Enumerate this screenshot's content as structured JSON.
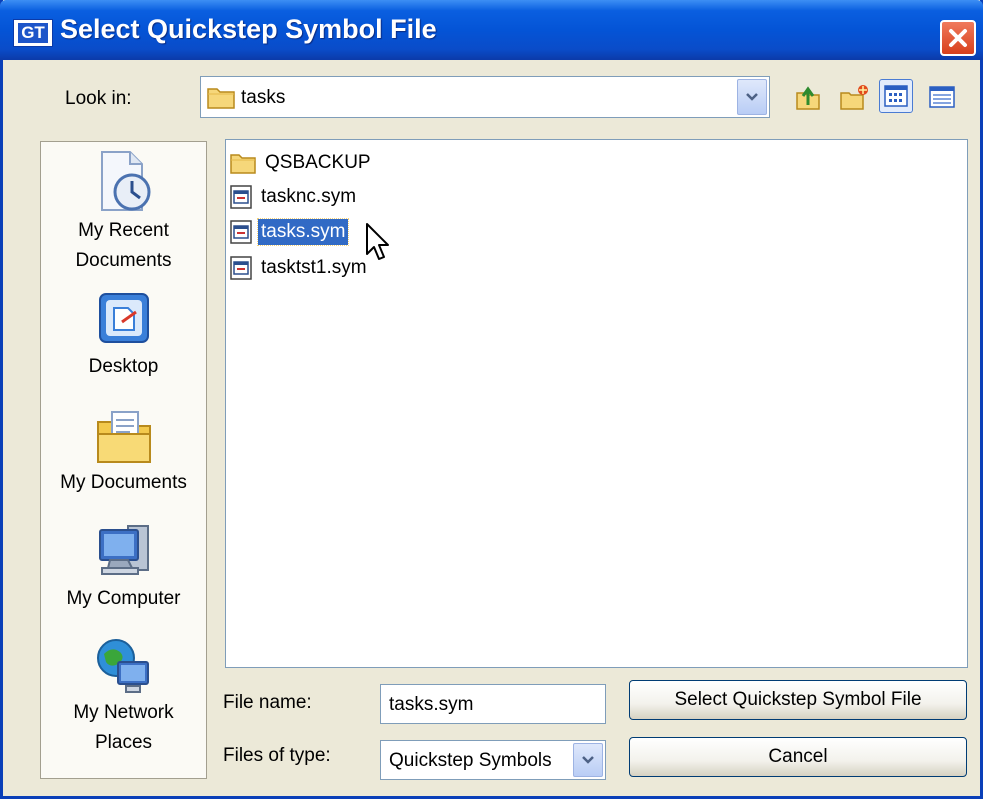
{
  "window": {
    "title": "Select Quickstep Symbol File",
    "app_icon_text": "GT",
    "close_icon": "close-icon"
  },
  "lookin": {
    "label": "Look in:",
    "value": "tasks",
    "icon": "folder-icon"
  },
  "toolbar": [
    {
      "name": "up-one-level-icon"
    },
    {
      "name": "create-new-folder-icon"
    },
    {
      "name": "list-view-icon",
      "active": true
    },
    {
      "name": "details-view-icon"
    }
  ],
  "places": [
    {
      "label": "My Recent Documents",
      "lines": [
        "My Recent",
        "Documents"
      ],
      "icon": "recent-documents-icon"
    },
    {
      "label": "Desktop",
      "lines": [
        "Desktop"
      ],
      "icon": "desktop-icon"
    },
    {
      "label": "My Documents",
      "lines": [
        "My Documents"
      ],
      "icon": "my-documents-icon"
    },
    {
      "label": "My Computer",
      "lines": [
        "My Computer"
      ],
      "icon": "my-computer-icon"
    },
    {
      "label": "My Network Places",
      "lines": [
        "My Network",
        "Places"
      ],
      "icon": "network-places-icon"
    }
  ],
  "files": [
    {
      "name": "QSBACKUP",
      "type": "folder",
      "selected": false
    },
    {
      "name": "tasknc.sym",
      "type": "file",
      "selected": false
    },
    {
      "name": "tasks.sym",
      "type": "file",
      "selected": true
    },
    {
      "name": "tasktst1.sym",
      "type": "file",
      "selected": false
    }
  ],
  "filename": {
    "label": "File name:",
    "value": "tasks.sym"
  },
  "filetype": {
    "label": "Files of type:",
    "value": "Quickstep Symbols"
  },
  "buttons": {
    "ok": "Select Quickstep Symbol File",
    "cancel": "Cancel"
  },
  "colors": {
    "titlebar": "#0454d6",
    "selection": "#316ac5",
    "dialog_bg": "#ece9d8"
  }
}
